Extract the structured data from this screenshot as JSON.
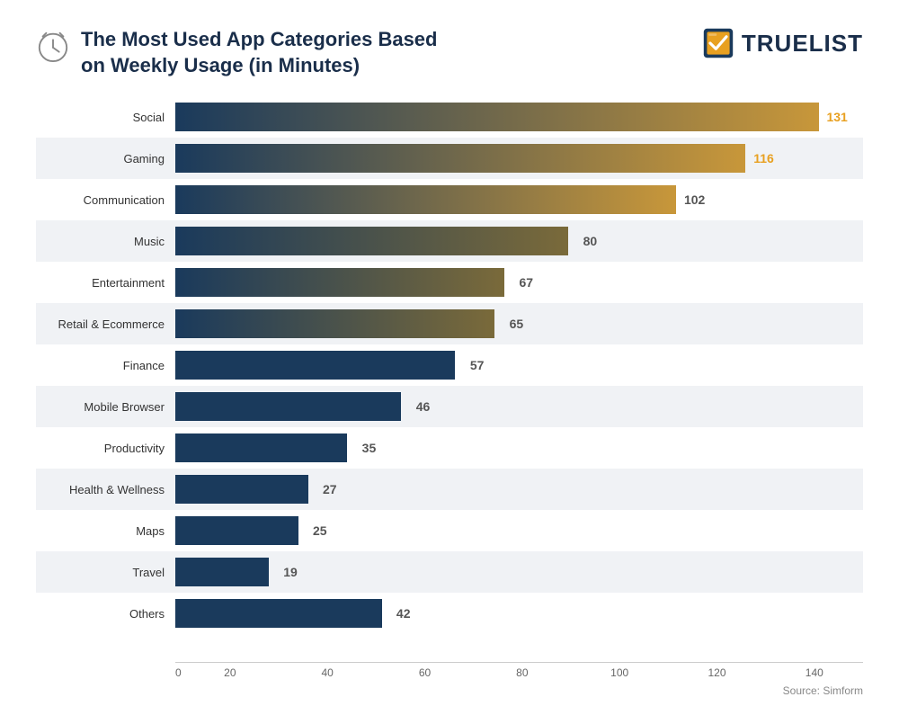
{
  "header": {
    "title_line1": "The Most Used App Categories Based",
    "title_line2": "on Weekly Usage (in Minutes)",
    "logo_text": "TRUELIST",
    "source": "Source: Simform"
  },
  "chart": {
    "max_value": 140,
    "x_ticks": [
      0,
      20,
      40,
      60,
      80,
      100,
      120,
      140
    ],
    "bars": [
      {
        "label": "Social",
        "value": 131,
        "highlight": true,
        "shaded": false
      },
      {
        "label": "Gaming",
        "value": 116,
        "highlight": true,
        "shaded": true
      },
      {
        "label": "Communication",
        "value": 102,
        "highlight": false,
        "shaded": false
      },
      {
        "label": "Music",
        "value": 80,
        "highlight": false,
        "shaded": true
      },
      {
        "label": "Entertainment",
        "value": 67,
        "highlight": false,
        "shaded": false
      },
      {
        "label": "Retail & Ecommerce",
        "value": 65,
        "highlight": false,
        "shaded": true
      },
      {
        "label": "Finance",
        "value": 57,
        "highlight": false,
        "shaded": false
      },
      {
        "label": "Mobile Browser",
        "value": 46,
        "highlight": false,
        "shaded": true
      },
      {
        "label": "Productivity",
        "value": 35,
        "highlight": false,
        "shaded": false
      },
      {
        "label": "Health & Wellness",
        "value": 27,
        "highlight": false,
        "shaded": true
      },
      {
        "label": "Maps",
        "value": 25,
        "highlight": false,
        "shaded": false
      },
      {
        "label": "Travel",
        "value": 19,
        "highlight": false,
        "shaded": true
      },
      {
        "label": "Others",
        "value": 42,
        "highlight": false,
        "shaded": false
      }
    ]
  }
}
